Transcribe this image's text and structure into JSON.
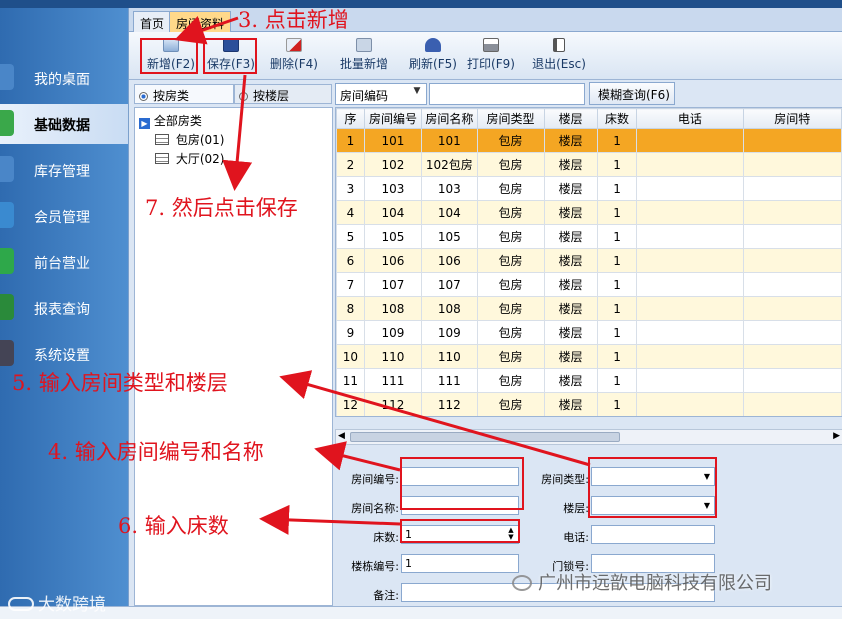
{
  "sidebar": {
    "items": [
      {
        "label": "我的桌面",
        "icon": "monitor-icon",
        "active": false
      },
      {
        "label": "基础数据",
        "icon": "database-icon",
        "active": true
      },
      {
        "label": "库存管理",
        "icon": "inventory-icon",
        "active": false
      },
      {
        "label": "会员管理",
        "icon": "members-icon",
        "active": false
      },
      {
        "label": "前台营业",
        "icon": "dollar-icon",
        "active": false
      },
      {
        "label": "报表查询",
        "icon": "chart-icon",
        "active": false
      },
      {
        "label": "系统设置",
        "icon": "gear-icon",
        "active": false
      }
    ]
  },
  "tabs": [
    {
      "label": "首页",
      "selected": false
    },
    {
      "label": "房间资料",
      "selected": true
    }
  ],
  "toolbar": {
    "buttons": [
      {
        "label": "新增(F2)",
        "icon": "add-icon"
      },
      {
        "label": "保存(F3)",
        "icon": "save-icon"
      },
      {
        "label": "删除(F4)",
        "icon": "delete-icon"
      },
      {
        "label": "批量新增",
        "icon": "batch-add-icon"
      },
      {
        "label": "刷新(F5)",
        "icon": "refresh-icon"
      },
      {
        "label": "打印(F9)",
        "icon": "print-icon"
      },
      {
        "label": "退出(Esc)",
        "icon": "exit-icon"
      }
    ]
  },
  "filter": {
    "by_type": "按房类",
    "by_floor": "按楼层",
    "by_type_selected": true,
    "search_field": "房间编码",
    "search_value": "",
    "fuzzy_button": "模糊查询(F6)"
  },
  "tree": {
    "root": "全部房类",
    "children": [
      "包房(01)",
      "大厅(02)"
    ]
  },
  "grid": {
    "columns": [
      "序",
      "房间编号",
      "房间名称",
      "房间类型",
      "楼层",
      "床数",
      "电话",
      "房间特"
    ],
    "rows": [
      [
        "1",
        "101",
        "101",
        "包房",
        "楼层",
        "1",
        ""
      ],
      [
        "2",
        "102",
        "102包房",
        "包房",
        "楼层",
        "1",
        ""
      ],
      [
        "3",
        "103",
        "103",
        "包房",
        "楼层",
        "1",
        ""
      ],
      [
        "4",
        "104",
        "104",
        "包房",
        "楼层",
        "1",
        ""
      ],
      [
        "5",
        "105",
        "105",
        "包房",
        "楼层",
        "1",
        ""
      ],
      [
        "6",
        "106",
        "106",
        "包房",
        "楼层",
        "1",
        ""
      ],
      [
        "7",
        "107",
        "107",
        "包房",
        "楼层",
        "1",
        ""
      ],
      [
        "8",
        "108",
        "108",
        "包房",
        "楼层",
        "1",
        ""
      ],
      [
        "9",
        "109",
        "109",
        "包房",
        "楼层",
        "1",
        ""
      ],
      [
        "10",
        "110",
        "110",
        "包房",
        "楼层",
        "1",
        ""
      ],
      [
        "11",
        "111",
        "111",
        "包房",
        "楼层",
        "1",
        ""
      ],
      [
        "12",
        "112",
        "112",
        "包房",
        "楼层",
        "1",
        ""
      ]
    ]
  },
  "form": {
    "room_no_label": "房间编号:",
    "room_no_value": "",
    "room_name_label": "房间名称:",
    "room_name_value": "",
    "room_type_label": "房间类型:",
    "room_type_value": "",
    "floor_label": "楼层:",
    "floor_value": "",
    "beds_label": "床数:",
    "beds_value": "1",
    "phone_label": "电话:",
    "phone_value": "",
    "building_label": "楼栋编号:",
    "building_value": "1",
    "door_lock_label": "门锁号:",
    "door_lock_value": "",
    "remark_label": "备注:",
    "remark_value": ""
  },
  "annotations": {
    "step3": "3. 点击新增",
    "step4": "4. 输入房间编号和名称",
    "step5": "5. 输入房间类型和楼层",
    "step6": "6. 输入床数",
    "step7": "7. 然后点击保存"
  },
  "watermarks": {
    "left": "大数跨境",
    "right": "广州市远歆电脑科技有限公司"
  },
  "colors": {
    "annotation_red": "#e0141e",
    "selected_row": "#f4a623",
    "alt_row": "#fff8dc",
    "sidebar_blue": "#3a78c0"
  }
}
